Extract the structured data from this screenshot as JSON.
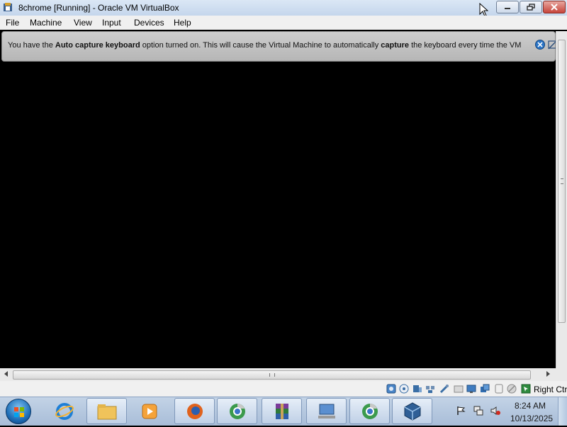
{
  "window": {
    "title": "8chrome [Running] - Oracle VM VirtualBox"
  },
  "menubar": {
    "items": [
      "File",
      "Machine",
      "View",
      "Input",
      "Devices",
      "Help"
    ]
  },
  "banner": {
    "text_1": "You have the ",
    "bold_1": "Auto capture keyboard",
    "text_2": " option turned on. This will cause the Virtual Machine to automatically ",
    "bold_2": "capture",
    "text_3": " the keyboard every time the VM"
  },
  "statusbar": {
    "host_key": "Right Ctrl",
    "icons": [
      "hard-disk-icon",
      "optical-drive-icon",
      "audio-icon",
      "network-icon",
      "usb-icon",
      "shared-folders-icon",
      "display-icon",
      "video-capture-icon",
      "recording-icon",
      "cpu-icon",
      "mouse-integration-icon",
      "keyboard-capture-icon"
    ]
  },
  "taskbar": {
    "apps": [
      "internet-explorer-icon",
      "file-explorer-icon",
      "media-player-icon",
      "firefox-icon",
      "chrome-icon",
      "winrar-icon",
      "network-computer-icon",
      "chrome-icon",
      "virtualbox-icon"
    ],
    "clock_time": "8:24 AM",
    "clock_date": "10/13/2025"
  },
  "colors": {
    "title_bar": "#c4d6ec",
    "banner": "#b6b6b6",
    "vm_screen": "#000000",
    "taskbar": "#a8bdd8",
    "close_button": "#c7443a"
  }
}
